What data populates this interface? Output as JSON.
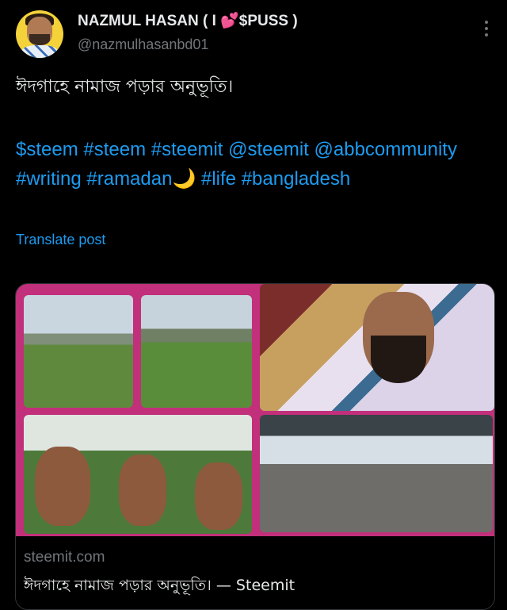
{
  "post": {
    "author_name": "NAZMUL HASAN ( I 💕$PUSS )",
    "handle": "@nazmulhasanbd01",
    "text": "ঈদগাহে নামাজ পড়ার অনুভূতি।",
    "tags": [
      "$steem",
      "#steem",
      "#steemit",
      "@steemit",
      "@abbcommunity",
      "#writing",
      "#ramadan🌙",
      "#life",
      "#bangladesh"
    ],
    "translate_label": "Translate post"
  },
  "card": {
    "domain": "steemit.com",
    "title": "ঈদগাহে নামাজ পড়ার অনুভূতি। — Steemit"
  },
  "icons": {
    "more": "more-options-icon"
  },
  "colors": {
    "background": "#000000",
    "link": "#1d9bf0",
    "secondary_text": "#71767b",
    "collage_border": "#c22f7b"
  }
}
